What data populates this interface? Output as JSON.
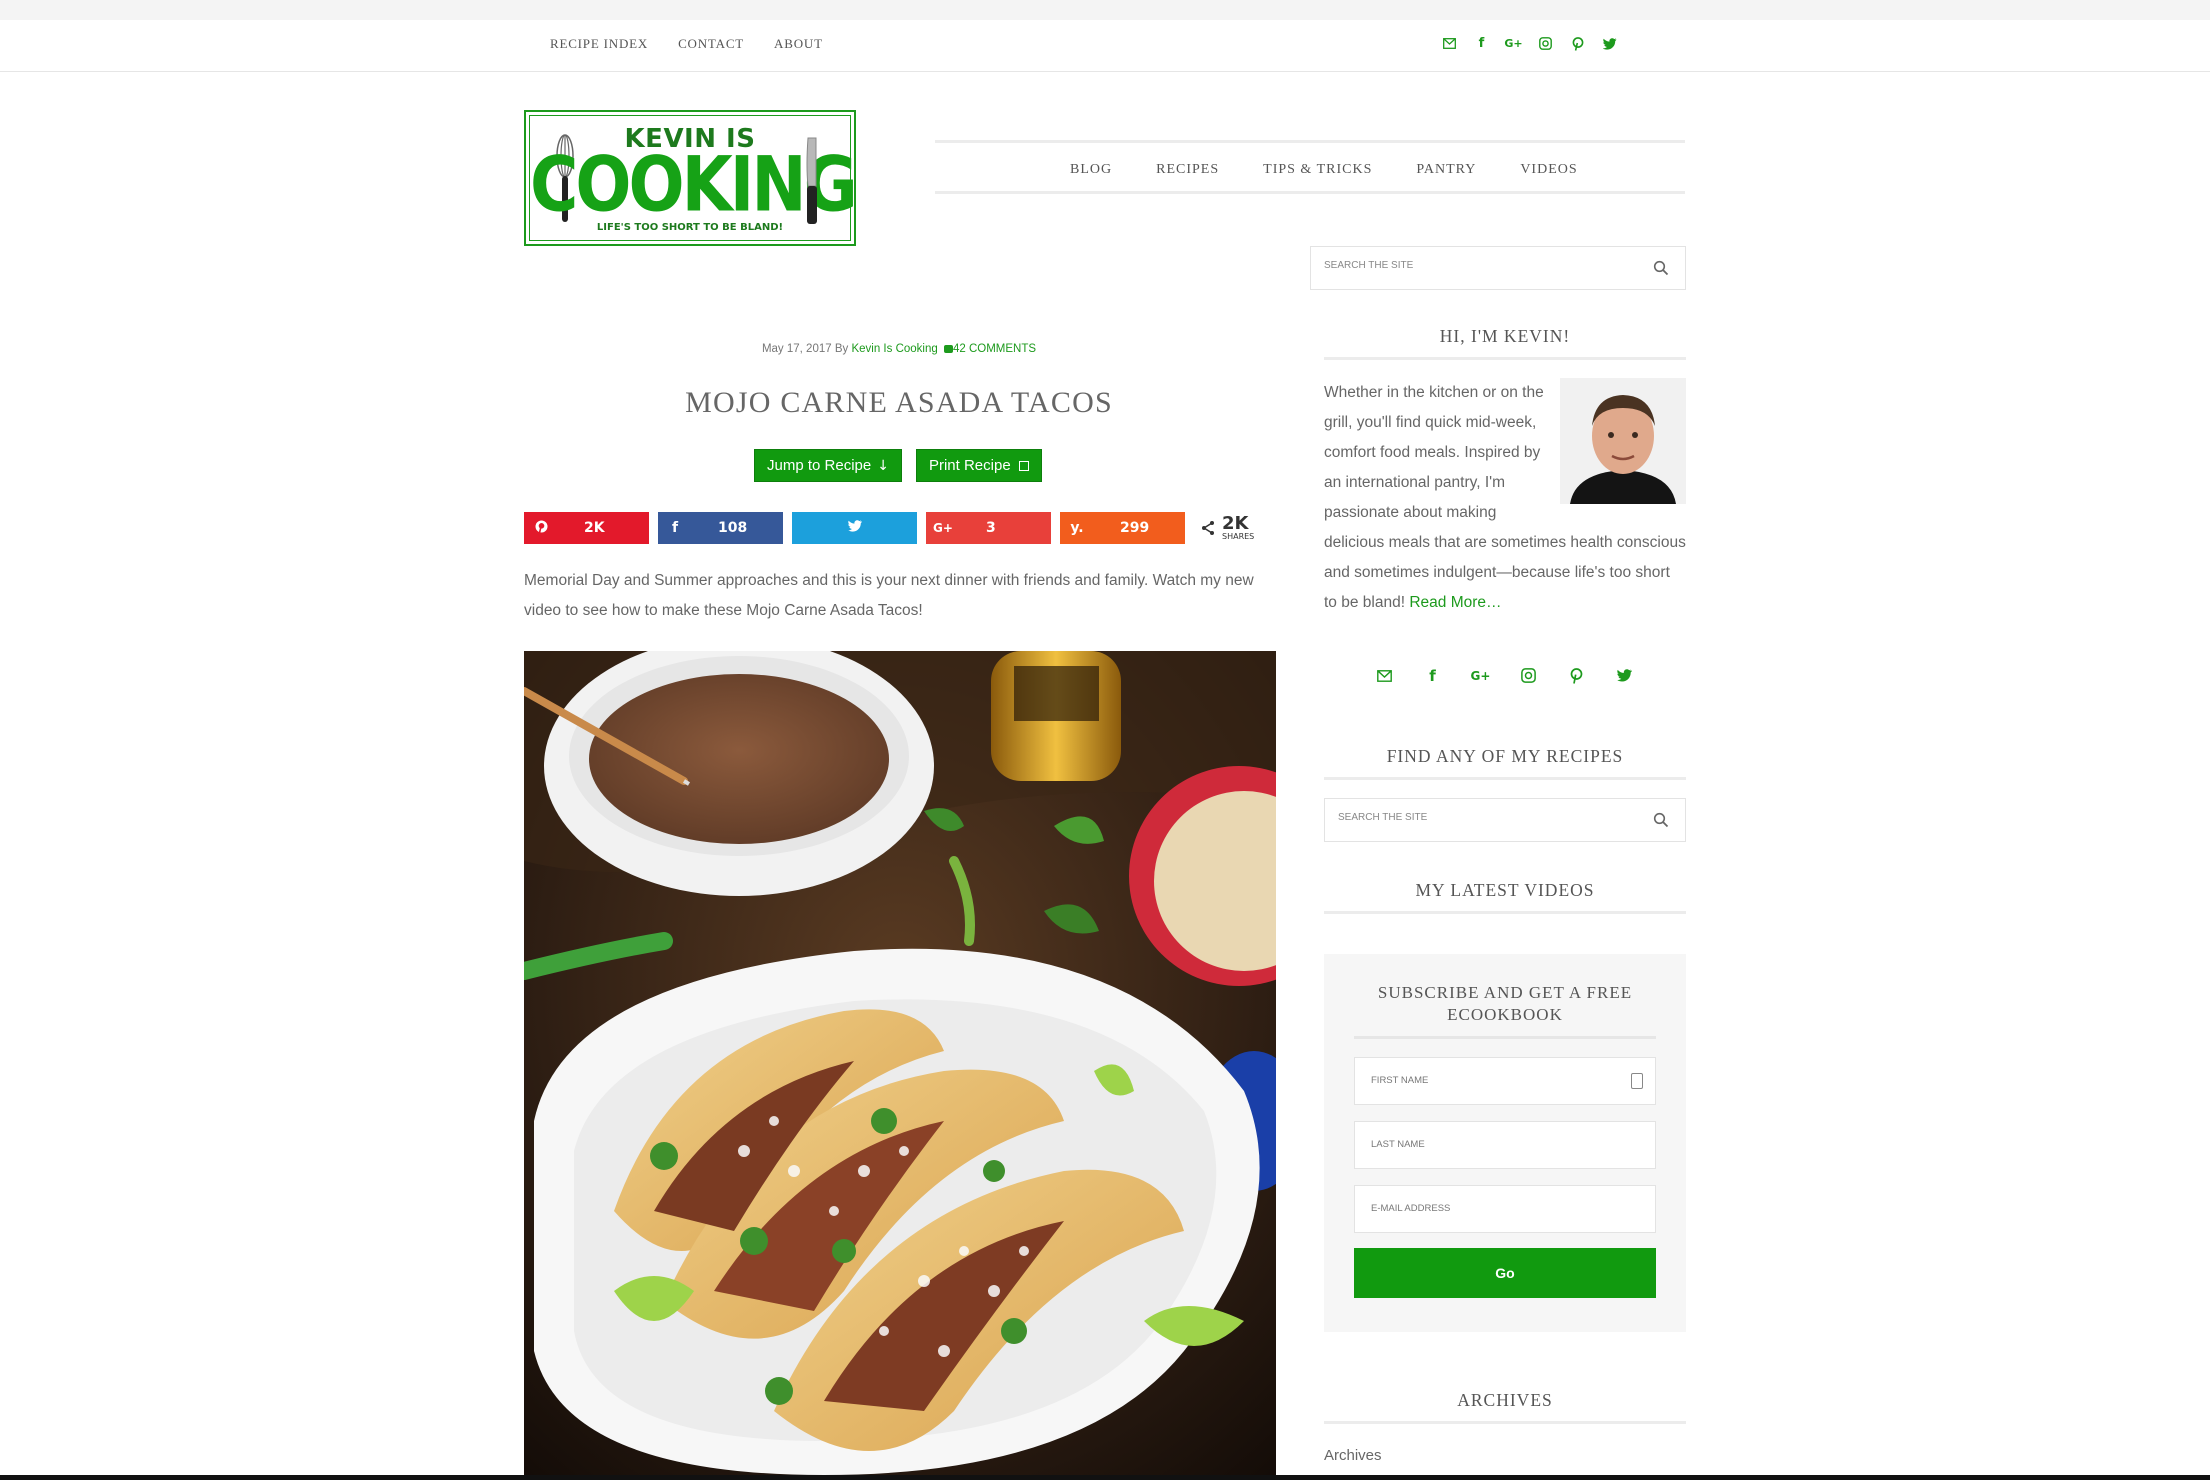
{
  "top_nav": {
    "items": [
      "RECIPE INDEX",
      "CONTACT",
      "ABOUT"
    ]
  },
  "social_icons": [
    "email-icon",
    "facebook-icon",
    "google-plus-icon",
    "instagram-icon",
    "pinterest-icon",
    "twitter-icon"
  ],
  "logo": {
    "line1": "KEVIN IS",
    "line2": "COOKING",
    "tagline": "LIFE'S TOO SHORT TO BE BLAND!"
  },
  "main_nav": {
    "items": [
      "BLOG",
      "RECIPES",
      "TIPS & TRICKS",
      "PANTRY",
      "VIDEOS"
    ]
  },
  "search": {
    "placeholder": "SEARCH THE SITE"
  },
  "post": {
    "date": "May 17, 2017",
    "by": "By",
    "author": "Kevin Is Cooking",
    "comments": "42 COMMENTS",
    "title": "MOJO CARNE ASADA TACOS",
    "jump_button": "Jump to Recipe",
    "print_button": "Print Recipe",
    "intro": "Memorial Day and Summer approaches and this is your next dinner with friends and family. Watch my new video to see how to make these Mojo Carne Asada Tacos!"
  },
  "share": {
    "buttons": [
      {
        "network": "pinterest",
        "icon": "pinterest-icon",
        "count": "2K",
        "color": "#e3192b"
      },
      {
        "network": "facebook",
        "icon": "facebook-icon",
        "count": "108",
        "color": "#365899"
      },
      {
        "network": "twitter",
        "icon": "twitter-icon",
        "count": "",
        "color": "#1ca0dc"
      },
      {
        "network": "google-plus",
        "icon": "google-plus-icon",
        "count": "3",
        "color": "#e8403a"
      },
      {
        "network": "yummly",
        "icon": "yummly-icon",
        "count": "299",
        "color": "#f25d1d"
      }
    ],
    "total": "2K",
    "total_label": "SHARES"
  },
  "sidebar": {
    "about_title": "HI, I'M KEVIN!",
    "about_text": "Whether in the kitchen or on the grill, you'll find quick mid-week, comfort food meals. Inspired by an international pantry, I'm passionate about making delicious meals that are sometimes health conscious and sometimes indulgent—because life's too short to be bland!",
    "read_more": "Read More…",
    "find_title": "FIND ANY OF MY RECIPES",
    "videos_title": "MY LATEST VIDEOS",
    "subscribe": {
      "title": "SUBSCRIBE AND GET A FREE ECOOKBOOK",
      "first_name": "FIRST NAME",
      "last_name": "LAST NAME",
      "email": "E-MAIL ADDRESS",
      "button": "Go"
    },
    "archives_title": "ARCHIVES",
    "archives_select": "Archives"
  },
  "colors": {
    "brand_green": "#119a0f",
    "link_green": "#1d9a1d"
  }
}
